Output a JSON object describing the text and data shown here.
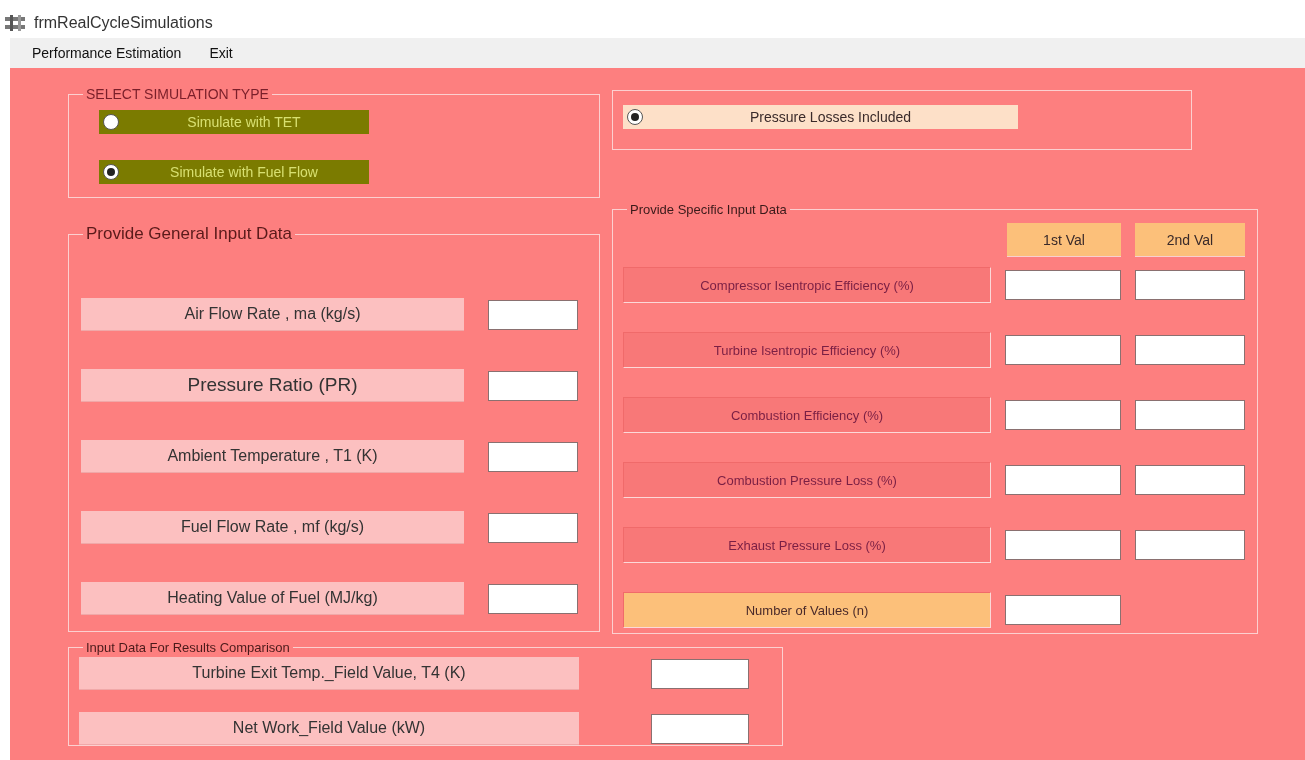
{
  "window": {
    "title": "frmRealCycleSimulations"
  },
  "menu": [
    "Performance Estimation",
    "Exit"
  ],
  "simulation_type": {
    "title": "SELECT SIMULATION TYPE",
    "options": [
      {
        "label": "Simulate with TET",
        "selected": false
      },
      {
        "label": "Simulate with Fuel Flow",
        "selected": true
      }
    ]
  },
  "pressure_losses": {
    "label": "Pressure Losses Included",
    "selected": true
  },
  "general_input": {
    "title": "Provide General Input Data",
    "rows": [
      {
        "label": "Air Flow Rate , ma (kg/s)"
      },
      {
        "label": "Pressure Ratio (PR)"
      },
      {
        "label": "Ambient Temperature , T1 (K)"
      },
      {
        "label": "Fuel Flow Rate , mf (kg/s)"
      },
      {
        "label": "Heating Value of Fuel (MJ/kg)"
      }
    ]
  },
  "specific_input": {
    "title": "Provide Specific Input Data",
    "columns": [
      "1st Val",
      "2nd Val"
    ],
    "rows": [
      {
        "label": "Compressor Isentropic Efficiency (%)",
        "kind": "pair"
      },
      {
        "label": "Turbine Isentropic Efficiency (%)",
        "kind": "pair"
      },
      {
        "label": "Combustion Efficiency (%)",
        "kind": "pair"
      },
      {
        "label": "Combustion Pressure Loss (%)",
        "kind": "pair"
      },
      {
        "label": "Exhaust Pressure Loss (%)",
        "kind": "pair"
      },
      {
        "label": "Number of Values (n)",
        "kind": "single"
      }
    ]
  },
  "comparison_input": {
    "title": "Input Data For Results Comparison",
    "rows": [
      {
        "label": "Turbine Exit Temp._Field Value, T4 (K)"
      },
      {
        "label": "Net Work_Field Value (kW)"
      }
    ]
  }
}
